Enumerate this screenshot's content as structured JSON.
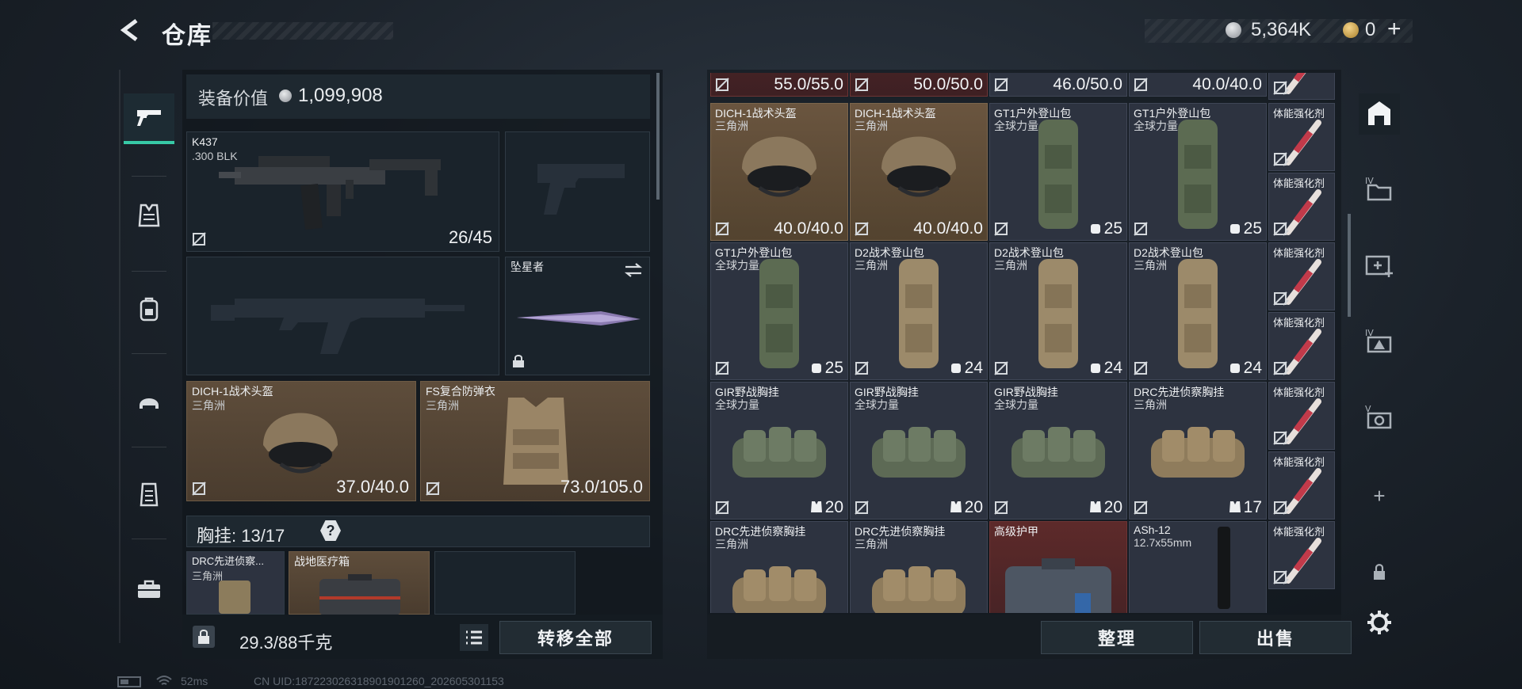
{
  "header": {
    "title": "仓库",
    "silver": "5,364K",
    "gold": "0"
  },
  "equipment": {
    "value_label": "装备价值",
    "value": "1,099,908",
    "primary": {
      "name": "K437",
      "ammo": ".300 BLK",
      "durability": "26/45"
    },
    "melee": {
      "name": "坠星者"
    },
    "helmet": {
      "name": "DICH-1战术头盔",
      "sub": "三角洲",
      "durability": "37.0/40.0"
    },
    "armor": {
      "name": "FS复合防弹衣",
      "sub": "三角洲",
      "durability": "73.0/105.0"
    },
    "vest": {
      "label": "胸挂: 13/17",
      "help": "?"
    },
    "vest_items": [
      {
        "name": "DRC先进侦察...",
        "sub": "三角洲"
      },
      {
        "name": "战地医疗箱",
        "sub": ""
      }
    ],
    "weight": "29.3/88千克",
    "transfer_label": "转移全部"
  },
  "inventory": {
    "top_values": [
      "55.0/55.0",
      "50.0/50.0",
      "46.0/50.0",
      "40.0/40.0"
    ],
    "items": [
      {
        "name": "DICH-1战术头盔",
        "sub": "三角洲",
        "value": "40.0/40.0",
        "kind": "helmet",
        "tone": "tan"
      },
      {
        "name": "DICH-1战术头盔",
        "sub": "三角洲",
        "value": "40.0/40.0",
        "kind": "helmet",
        "tone": "tan"
      },
      {
        "name": "GT1户外登山包",
        "sub": "全球力量",
        "value": "25",
        "kind": "bag-green",
        "tone": ""
      },
      {
        "name": "GT1户外登山包",
        "sub": "全球力量",
        "value": "25",
        "kind": "bag-green",
        "tone": ""
      },
      {
        "name": "GT1户外登山包",
        "sub": "全球力量",
        "value": "25",
        "kind": "bag-green",
        "tone": ""
      },
      {
        "name": "D2战术登山包",
        "sub": "三角洲",
        "value": "24",
        "kind": "bag-tan",
        "tone": ""
      },
      {
        "name": "D2战术登山包",
        "sub": "三角洲",
        "value": "24",
        "kind": "bag-tan",
        "tone": ""
      },
      {
        "name": "D2战术登山包",
        "sub": "三角洲",
        "value": "24",
        "kind": "bag-tan",
        "tone": ""
      },
      {
        "name": "GIR野战胸挂",
        "sub": "全球力量",
        "value": "20",
        "kind": "rig-green",
        "tone": ""
      },
      {
        "name": "GIR野战胸挂",
        "sub": "全球力量",
        "value": "20",
        "kind": "rig-green",
        "tone": ""
      },
      {
        "name": "GIR野战胸挂",
        "sub": "全球力量",
        "value": "20",
        "kind": "rig-green",
        "tone": ""
      },
      {
        "name": "DRC先进侦察胸挂",
        "sub": "三角洲",
        "value": "17",
        "kind": "rig-tan",
        "tone": ""
      },
      {
        "name": "DRC先进侦察胸挂",
        "sub": "三角洲",
        "value": "",
        "kind": "rig-tan",
        "tone": ""
      },
      {
        "name": "DRC先进侦察胸挂",
        "sub": "三角洲",
        "value": "",
        "kind": "rig-tan",
        "tone": ""
      },
      {
        "name": "高级护甲",
        "sub": "",
        "value": "",
        "kind": "armor-box",
        "tone": "red"
      },
      {
        "name": "ASh-12",
        "sub": "12.7x55mm",
        "value": "",
        "kind": "ammo",
        "tone": ""
      }
    ],
    "stim_label": "体能强化剂",
    "organize_label": "整理",
    "sell_label": "出售"
  },
  "status": {
    "ping": "52ms",
    "uid": "CN UID:1872230263189019012​60_202605301153"
  },
  "colors": {
    "accent": "#37c9a6",
    "tan": "#5e4d3b",
    "cell": "#2d3340",
    "red": "#5d2a2a"
  }
}
